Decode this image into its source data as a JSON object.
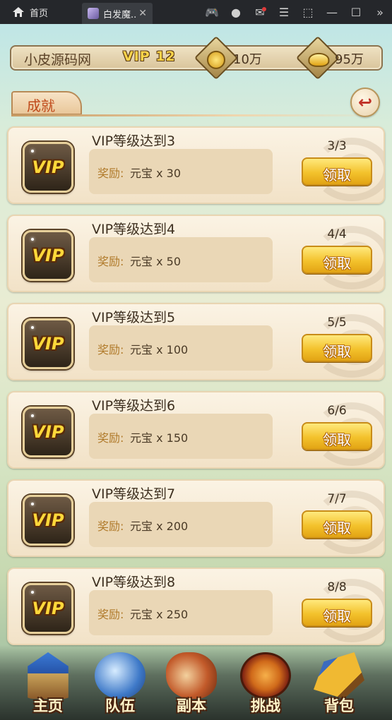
{
  "window": {
    "home_tab": "首页",
    "game_tab": "白发魔..."
  },
  "game": {
    "player_name": "小皮源码网",
    "vip_label": "VIP 12",
    "coins": "10万",
    "ingots": "95万",
    "section_title": "成就"
  },
  "achievements": [
    {
      "title": "VIP等级达到3",
      "reward_label": "奖励:",
      "reward": "元宝 x 30",
      "progress": "3/3",
      "button": "领取"
    },
    {
      "title": "VIP等级达到4",
      "reward_label": "奖励:",
      "reward": "元宝 x 50",
      "progress": "4/4",
      "button": "领取"
    },
    {
      "title": "VIP等级达到5",
      "reward_label": "奖励:",
      "reward": "元宝 x 100",
      "progress": "5/5",
      "button": "领取"
    },
    {
      "title": "VIP等级达到6",
      "reward_label": "奖励:",
      "reward": "元宝 x 150",
      "progress": "6/6",
      "button": "领取"
    },
    {
      "title": "VIP等级达到7",
      "reward_label": "奖励:",
      "reward": "元宝 x 200",
      "progress": "7/7",
      "button": "领取"
    },
    {
      "title": "VIP等级达到8",
      "reward_label": "奖励:",
      "reward": "元宝 x 250",
      "progress": "8/8",
      "button": "领取"
    }
  ],
  "badge_text": "VIP",
  "nav": [
    {
      "label": "主页",
      "icon": "palace-icon"
    },
    {
      "label": "队伍",
      "icon": "team-banner-icon"
    },
    {
      "label": "副本",
      "icon": "dungeon-gourd-icon"
    },
    {
      "label": "挑战",
      "icon": "drum-icon"
    },
    {
      "label": "背包",
      "icon": "bag-sword-icon"
    }
  ]
}
